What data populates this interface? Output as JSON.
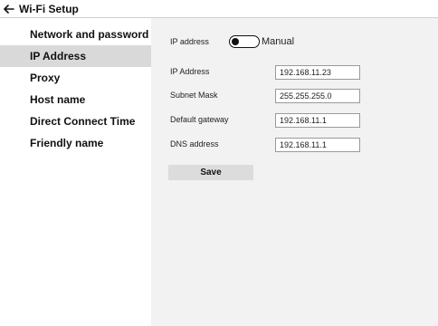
{
  "header": {
    "title": "Wi-Fi Setup",
    "back_icon": "arrow-left-icon"
  },
  "sidebar": {
    "items": [
      {
        "label": "Network and password"
      },
      {
        "label": "IP Address",
        "active": true
      },
      {
        "label": "Proxy"
      },
      {
        "label": "Host name"
      },
      {
        "label": "Direct Connect Time"
      },
      {
        "label": "Friendly name"
      }
    ]
  },
  "ip": {
    "mode_label": "IP address",
    "mode_value": "Manual",
    "fields": [
      {
        "label": "IP Address",
        "value": "192.168.11.23"
      },
      {
        "label": "Subnet Mask",
        "value": "255.255.255.0"
      },
      {
        "label": "Default gateway",
        "value": "192.168.11.1"
      },
      {
        "label": "DNS address",
        "value": "192.168.11.1"
      }
    ],
    "save_label": "Save"
  }
}
